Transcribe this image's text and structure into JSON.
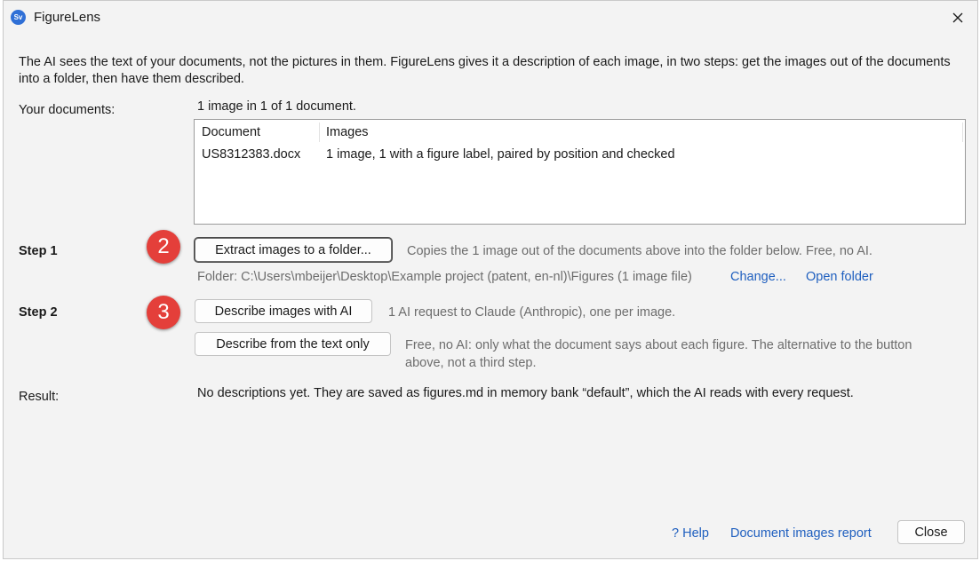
{
  "window": {
    "title": "FigureLens",
    "app_icon_text": "Sv",
    "close_icon": "close-icon"
  },
  "intro": "The AI sees the text of your documents, not the pictures in them. FigureLens gives it a description of each image, in two steps: get the images out of the documents into a folder, then have them described.",
  "documents": {
    "label": "Your documents:",
    "summary": "1 image in 1 of 1 document.",
    "columns": [
      "Document",
      "Images"
    ],
    "rows": [
      {
        "document": "US8312383.docx",
        "images": "1 image, 1 with a figure label, paired by position and checked"
      }
    ]
  },
  "step1": {
    "label": "Step 1",
    "badge": "2",
    "button": "Extract images to a folder...",
    "description": "Copies the 1 image out of the documents above into the folder below. Free, no AI.",
    "folder_text": "Folder: C:\\Users\\mbeijer\\Desktop\\Example project (patent, en-nl)\\Figures  (1 image file)",
    "change_link": "Change...",
    "open_link": "Open folder"
  },
  "step2": {
    "label": "Step 2",
    "badge": "3",
    "button_ai": "Describe images with AI",
    "ai_description": "1 AI request to Claude (Anthropic), one per image.",
    "button_text_only": "Describe from the text only",
    "text_only_description_line1": "Free, no AI: only what the document says about each figure. The alternative to the button",
    "text_only_description_line2": "above, not a third step."
  },
  "result": {
    "label": "Result:",
    "text": "No descriptions yet. They are saved as figures.md in memory bank “default”, which the AI reads with every request."
  },
  "footer": {
    "help_link": "? Help",
    "report_link": "Document images report",
    "close_button": "Close"
  },
  "colors": {
    "badge": "#e43f3a",
    "link": "#1f5fbf",
    "window_bg": "#f3f3f3"
  }
}
